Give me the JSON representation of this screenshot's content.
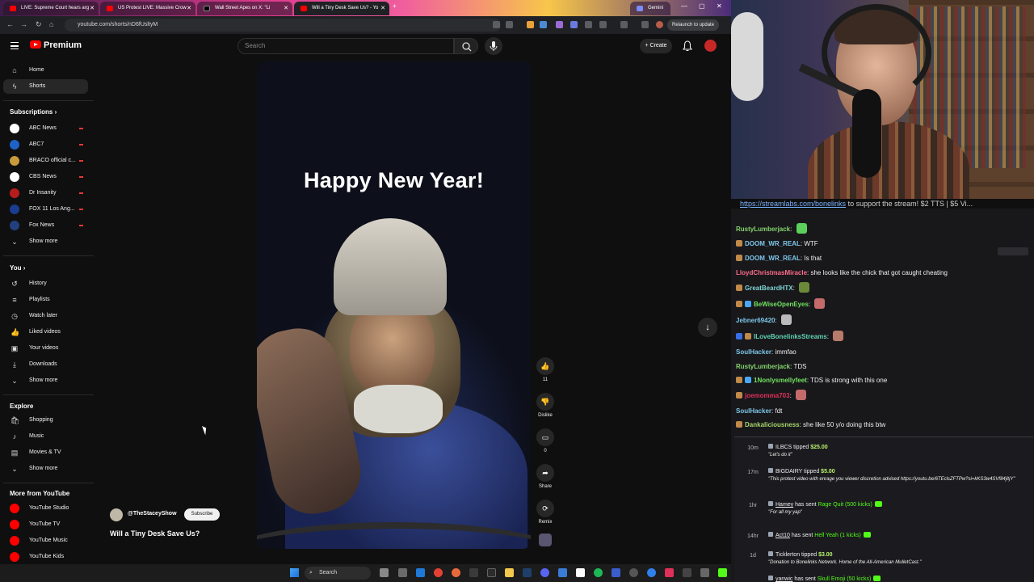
{
  "browser": {
    "tabs": [
      {
        "title": "LIVE: Supreme Court hears arg",
        "active": false
      },
      {
        "title": "US Protest LIVE: Massive Crow",
        "active": false
      },
      {
        "title": "Wall Street Apes on X: \"Li",
        "active": false
      },
      {
        "title": "Will a Tiny Desk Save Us? - Yo",
        "active": true
      },
      {
        "title": "Gemini",
        "active": false
      }
    ],
    "url": "youtube.com/shorts/nD6fUsltyM",
    "relaunch_label": "Relaunch to update"
  },
  "yt": {
    "logo_text": "Premium",
    "search_placeholder": "Search",
    "create_label": "Create"
  },
  "sidebar": {
    "top": [
      {
        "label": "Home",
        "icon": "home-icon",
        "glyph": "⌂",
        "active": false
      },
      {
        "label": "Shorts",
        "icon": "shorts-icon",
        "glyph": "ϟ",
        "active": true
      }
    ],
    "subscriptions_title": "Subscriptions",
    "subscriptions": [
      {
        "label": "ABC News",
        "color": "#ffffff",
        "live": true
      },
      {
        "label": "ABC7",
        "color": "#1e63c6",
        "live": true
      },
      {
        "label": "BRACO official c...",
        "color": "#c89a3a",
        "live": true
      },
      {
        "label": "CBS News",
        "color": "#ffffff",
        "live": true
      },
      {
        "label": "Dr Insanity",
        "color": "#b71c1c",
        "live": true
      },
      {
        "label": "FOX 11 Los Ang...",
        "color": "#1a3d8f",
        "live": true
      },
      {
        "label": "Fox News",
        "color": "#23407e",
        "live": true
      }
    ],
    "show_more": "Show more",
    "you_title": "You",
    "you": [
      {
        "label": "History",
        "glyph": "↺"
      },
      {
        "label": "Playlists",
        "glyph": "≡"
      },
      {
        "label": "Watch later",
        "glyph": "◷"
      },
      {
        "label": "Liked videos",
        "glyph": "👍"
      },
      {
        "label": "Your videos",
        "glyph": "▣"
      },
      {
        "label": "Downloads",
        "glyph": "⤓"
      }
    ],
    "explore_title": "Explore",
    "explore": [
      {
        "label": "Shopping",
        "glyph": "🛍"
      },
      {
        "label": "Music",
        "glyph": "♪"
      },
      {
        "label": "Movies & TV",
        "glyph": "▤"
      }
    ],
    "more_title": "More from YouTube",
    "more": [
      {
        "label": "YouTube Studio",
        "color": "#ff0000"
      },
      {
        "label": "YouTube TV",
        "color": "#ff0000"
      },
      {
        "label": "YouTube Music",
        "color": "#ff0000"
      },
      {
        "label": "YouTube Kids",
        "color": "#ff0000"
      }
    ]
  },
  "short": {
    "caption": "Happy New Year!",
    "like_count": "11",
    "dislike_label": "Dislike",
    "comment_count": "0",
    "share_label": "Share",
    "remix_label": "Remix",
    "channel": "@TheStaceyShow",
    "subscribe_label": "Subscribe",
    "title": "Will a Tiny Desk Save Us?"
  },
  "taskbar": {
    "search_label": "Search"
  },
  "stream": {
    "ticker_link": "https://streamlabs.com/bonelinks",
    "ticker_text": " to support the stream! $2 TTS | $5 Vi..."
  },
  "chat": [
    {
      "user": "RustyLumberjack",
      "color": "#84d36a",
      "text": "",
      "emote": "#5bd15b",
      "badges": []
    },
    {
      "user": "DOOM_WR_REAL",
      "color": "#7ec6e8",
      "text": "WTF",
      "emote": "",
      "badges": [
        "#c08a4a"
      ]
    },
    {
      "user": "DOOM_WR_REAL",
      "color": "#7ec6e8",
      "text": "Is that",
      "emote": "",
      "badges": [
        "#c08a4a"
      ]
    },
    {
      "user": "LloydChristmasMiracle",
      "color": "#ff6b8a",
      "text": "she looks like the chick that got caught cheating",
      "emote": "",
      "badges": []
    },
    {
      "user": "GreatBeardHTX",
      "color": "#7ed4d4",
      "text": "",
      "emote": "#6a8a3a",
      "badges": [
        "#c08a4a"
      ]
    },
    {
      "user": "BeWiseOpenEyes",
      "color": "#71e25f",
      "text": "",
      "emote": "#c46a6a",
      "badges": [
        "#c08a4a",
        "#49a7f5"
      ]
    },
    {
      "user": "Jebner69420",
      "color": "#7ec6e8",
      "text": "",
      "emote": "#bbbbbb",
      "badges": []
    },
    {
      "user": "ILoveBonelinksStreams",
      "color": "#5fd4b4",
      "text": "",
      "emote": "#b87a6a",
      "badges": [
        "#3a6ee8",
        "#c08a4a"
      ]
    },
    {
      "user": "SoulHacker",
      "color": "#7ec6e8",
      "text": "immfao",
      "emote": "",
      "badges": []
    },
    {
      "user": "RustyLumberjack",
      "color": "#84d36a",
      "text": "TDS",
      "emote": "",
      "badges": []
    },
    {
      "user": "1Nonlysmellyfeet",
      "color": "#71e25f",
      "text": "TDS is strong with this one",
      "emote": "",
      "badges": [
        "#c08a4a",
        "#49a7f5"
      ]
    },
    {
      "user": "joemomma703",
      "color": "#e0305a",
      "text": "",
      "emote": "#c46a6a",
      "badges": [
        "#c08a4a"
      ]
    },
    {
      "user": "SoulHacker",
      "color": "#7ec6e8",
      "text": "fdt",
      "emote": "",
      "badges": []
    },
    {
      "user": "Dankaliciousness",
      "color": "#a5d46a",
      "text": "she like 50 y/o doing this btw",
      "emote": "",
      "badges": [
        "#c08a4a"
      ]
    }
  ],
  "events": [
    {
      "time": "10m",
      "who": "ILBCS",
      "action": "tipped",
      "amount": "$25.00",
      "message": "\"Let's do it\"",
      "kick": false
    },
    {
      "time": "17m",
      "who": "BIGDAIRY",
      "action": "tipped",
      "amount": "$5.00",
      "message": "\"This protest video with enrage you viewer discretion advised https://youtu.be/6TEclsZFTPw?si=kKS3w4SVf84jltjY\"",
      "kick": false
    },
    {
      "time": "1hr",
      "who": "Hamey",
      "action": "has sent",
      "amount": "Rage Quit (500 kicks)",
      "message": "\"For all my yap\"",
      "kick": true
    },
    {
      "time": "14hr",
      "who": "Act10",
      "action": "has sent",
      "amount": "Hell Yeah (1 kicks)",
      "message": "",
      "kick": true
    },
    {
      "time": "1d",
      "who": "Ticklerton",
      "action": "tipped",
      "amount": "$3.00",
      "message": "\"Donation to Bonelinks Network. Home of the All-American MulletCast.\"",
      "kick": false
    },
    {
      "time": "",
      "who": "yanwic",
      "action": "has sent",
      "amount": "Skull Emoji (50 kicks)",
      "message": "",
      "kick": true
    }
  ]
}
